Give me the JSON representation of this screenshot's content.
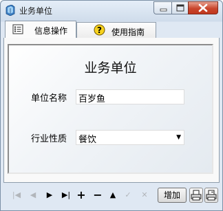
{
  "window": {
    "title": "业务单位"
  },
  "tabs": [
    {
      "label": "信息操作",
      "icon": "list-icon",
      "active": true
    },
    {
      "label": "使用指南",
      "icon": "help-icon",
      "active": false
    }
  ],
  "form": {
    "heading": "业务单位",
    "fields": [
      {
        "label": "单位名称",
        "value": "百岁鱼",
        "type": "text"
      },
      {
        "label": "行业性质",
        "value": "餐饮",
        "type": "select"
      }
    ]
  },
  "toolbar": {
    "add_label": "增加",
    "nav_icons": [
      "first-record-icon",
      "prev-record-icon",
      "next-record-icon",
      "last-record-icon",
      "insert-icon",
      "delete-icon",
      "edit-icon",
      "post-icon",
      "cancel-icon",
      "print-icon",
      "print-preview-icon"
    ]
  },
  "colors": {
    "close_button": "#c9462c",
    "titlebar": "#d8e4f2"
  }
}
